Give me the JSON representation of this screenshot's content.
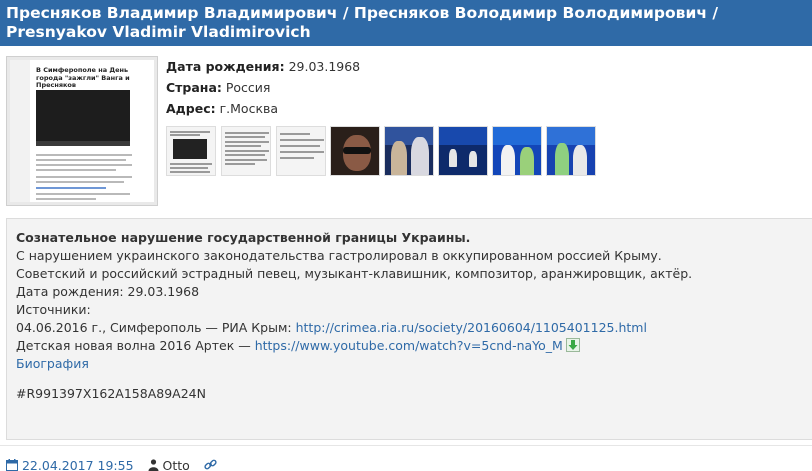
{
  "title": "Пресняков Владимир Владимирович / Пресняков Володимир Володимирович / Presnyakov Vladimir Vladimirovich",
  "main_photo": {
    "headline": "В Симферополе на День города \"зажгли\" Ванга и Пресняков"
  },
  "info": {
    "birth_label": "Дата рождения:",
    "birth_value": "29.03.1968",
    "country_label": "Страна:",
    "country_value": "Россия",
    "address_label": "Адрес:",
    "address_value": "г.Москва"
  },
  "notice": {
    "heading": "Сознательное нарушение государственной границы Украины.",
    "line1": "С нарушением украинского законодательства гастролировал в оккупированном россией Крыму.",
    "line2": "Советский и российский эстрадный певец, музыкант-клавишник, композитор, аранжировщик, актёр.",
    "line3": "Дата рождения: 29.03.1968",
    "line4": "Источники:",
    "source1_text": "04.06.2016 г., Симферополь — РИА Крым: ",
    "source1_link": "http://crimea.ria.ru/society/20160604/1105401125.html",
    "source2_text": "Детская новая волна 2016 Артек — ",
    "source2_link": "https://www.youtube.com/watch?v=5cnd-naYo_M",
    "bio_link": "Биография",
    "hash": "#R991397X162A158A89A24N"
  },
  "footer": {
    "date": "22.04.2017 19:55",
    "author": "Otto"
  },
  "colors": {
    "accent": "#2f6aa7",
    "notice_bg": "#f3f3f3",
    "download_green": "#3aa845"
  },
  "icons": [
    "calendar-icon",
    "user-icon",
    "link-icon",
    "download-icon"
  ]
}
